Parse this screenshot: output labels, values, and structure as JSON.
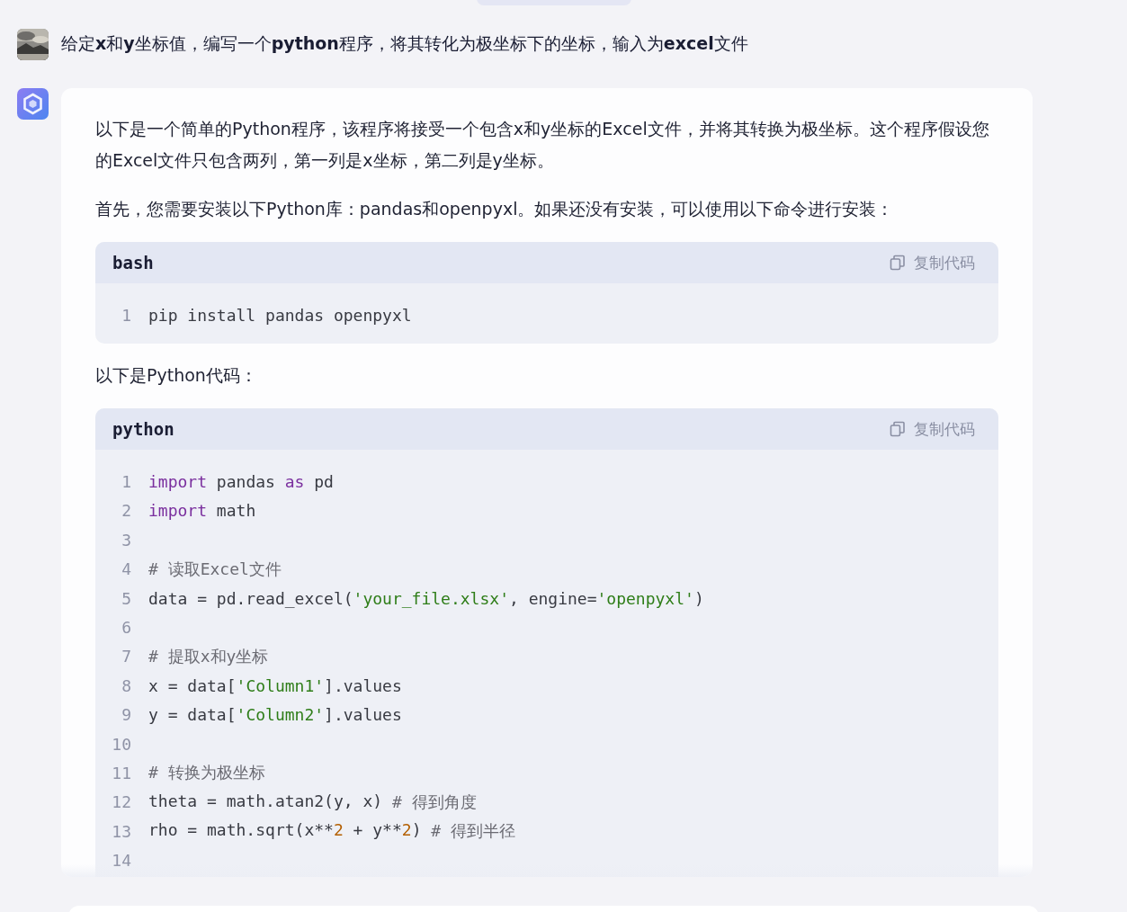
{
  "question": {
    "text": "给定**x**和**y**坐标值，编写一个**python**程序，将其转化为极坐标下的坐标，输入为**excel**文件"
  },
  "answer": {
    "blocks": [
      {
        "kind": "para",
        "text": "以下是一个简单的Python程序，该程序将接受一个包含x和y坐标的Excel文件，并将其转换为极坐标。这个程序假设您的Excel文件只包含两列，第一列是x坐标，第二列是y坐标。"
      },
      {
        "kind": "para",
        "text": "首先，您需要安装以下Python库：pandas和openpyxl。如果还没有安装，可以使用以下命令进行安装："
      },
      {
        "kind": "code",
        "language": "bash",
        "copy_label": "复制代码",
        "lines": [
          {
            "num": "1",
            "tokens": [
              {
                "kind": "plain",
                "t": "pip install pandas openpyxl"
              }
            ]
          }
        ]
      },
      {
        "kind": "para",
        "text": "以下是Python代码："
      },
      {
        "kind": "code",
        "language": "python",
        "copy_label": "复制代码",
        "lines": [
          {
            "num": "1",
            "tokens": [
              {
                "kind": "kw",
                "t": "import"
              },
              {
                "kind": "plain",
                "t": " pandas "
              },
              {
                "kind": "kw",
                "t": "as"
              },
              {
                "kind": "plain",
                "t": " pd"
              }
            ]
          },
          {
            "num": "2",
            "tokens": [
              {
                "kind": "kw",
                "t": "import"
              },
              {
                "kind": "plain",
                "t": " math"
              }
            ]
          },
          {
            "num": "3"
          },
          {
            "num": "4",
            "tokens": [
              {
                "kind": "comment",
                "t": "# 读取Excel文件"
              }
            ]
          },
          {
            "num": "5",
            "tokens": [
              {
                "kind": "plain",
                "t": "data = pd.read_excel("
              },
              {
                "kind": "str",
                "t": "'your_file.xlsx'"
              },
              {
                "kind": "plain",
                "t": ", engine="
              },
              {
                "kind": "str",
                "t": "'openpyxl'"
              },
              {
                "kind": "plain",
                "t": ")"
              }
            ]
          },
          {
            "num": "6"
          },
          {
            "num": "7",
            "tokens": [
              {
                "kind": "comment",
                "t": "# 提取x和y坐标"
              }
            ]
          },
          {
            "num": "8",
            "tokens": [
              {
                "kind": "plain",
                "t": "x = data["
              },
              {
                "kind": "str",
                "t": "'Column1'"
              },
              {
                "kind": "plain",
                "t": "].values"
              }
            ]
          },
          {
            "num": "9",
            "tokens": [
              {
                "kind": "plain",
                "t": "y = data["
              },
              {
                "kind": "str",
                "t": "'Column2'"
              },
              {
                "kind": "plain",
                "t": "].values"
              }
            ]
          },
          {
            "num": "10"
          },
          {
            "num": "11",
            "tokens": [
              {
                "kind": "comment",
                "t": "# 转换为极坐标"
              }
            ]
          },
          {
            "num": "12",
            "tokens": [
              {
                "kind": "plain",
                "t": "theta = math.atan2(y, x) "
              },
              {
                "kind": "comment",
                "t": "# 得到角度"
              }
            ]
          },
          {
            "num": "13",
            "tokens": [
              {
                "kind": "plain",
                "t": "rho = math.sqrt(x**"
              },
              {
                "kind": "num",
                "t": "2"
              },
              {
                "kind": "plain",
                "t": " + y**"
              },
              {
                "kind": "num",
                "t": "2"
              },
              {
                "kind": "plain",
                "t": ") "
              },
              {
                "kind": "comment",
                "t": "# 得到半径"
              }
            ]
          },
          {
            "num": "14"
          }
        ]
      }
    ]
  }
}
